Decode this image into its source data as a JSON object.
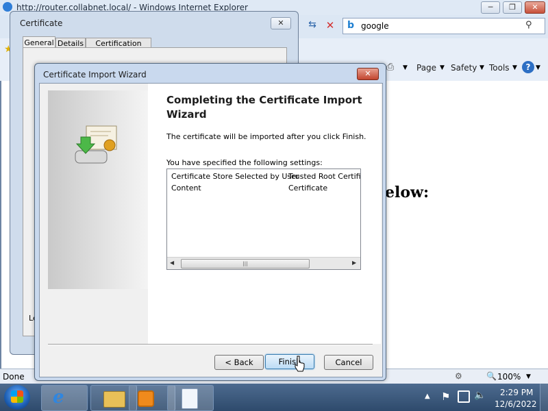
{
  "ie": {
    "title": "http://router.collabnet.local/ - Windows Internet Explorer",
    "search_value": "google",
    "toolbar": {
      "page": "Page",
      "safety": "Safety",
      "tools": "Tools"
    },
    "content_fragment": "elow:",
    "status": "Done",
    "zoom": "100%"
  },
  "cert": {
    "title": "Certificate",
    "tabs": [
      "General",
      "Details",
      "Certification Path"
    ],
    "left_fragment": "Le"
  },
  "wizard": {
    "title": "Certificate Import Wizard",
    "heading": "Completing the Certificate Import Wizard",
    "description": "The certificate will be imported after you click Finish.",
    "settings_label": "You have specified the following settings:",
    "settings": [
      {
        "name": "Certificate Store Selected by User",
        "value": "Trusted Root Certifica"
      },
      {
        "name": "Content",
        "value": "Certificate"
      }
    ],
    "scroll_thumb_glyph": "|||",
    "buttons": {
      "back": "< Back",
      "finish": "Finish",
      "cancel": "Cancel"
    }
  },
  "clock": {
    "time": "2:29 PM",
    "date": "12/6/2022"
  }
}
